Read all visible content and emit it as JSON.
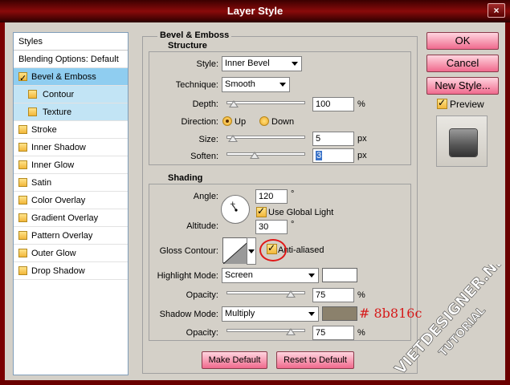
{
  "window": {
    "title": "Layer Style",
    "close_glyph": "×"
  },
  "styles_panel": {
    "header": "Styles",
    "items": [
      {
        "label": "Blending Options: Default",
        "checkbox": false,
        "checked": false,
        "indent": false,
        "selected": false
      },
      {
        "label": "Bevel & Emboss",
        "checkbox": true,
        "checked": true,
        "indent": false,
        "selected": true
      },
      {
        "label": "Contour",
        "checkbox": true,
        "checked": false,
        "indent": true,
        "selected": "sub"
      },
      {
        "label": "Texture",
        "checkbox": true,
        "checked": false,
        "indent": true,
        "selected": "sub"
      },
      {
        "label": "Stroke",
        "checkbox": true,
        "checked": false,
        "indent": false,
        "selected": false
      },
      {
        "label": "Inner Shadow",
        "checkbox": true,
        "checked": false,
        "indent": false,
        "selected": false
      },
      {
        "label": "Inner Glow",
        "checkbox": true,
        "checked": false,
        "indent": false,
        "selected": false
      },
      {
        "label": "Satin",
        "checkbox": true,
        "checked": false,
        "indent": false,
        "selected": false
      },
      {
        "label": "Color Overlay",
        "checkbox": true,
        "checked": false,
        "indent": false,
        "selected": false
      },
      {
        "label": "Gradient Overlay",
        "checkbox": true,
        "checked": false,
        "indent": false,
        "selected": false
      },
      {
        "label": "Pattern Overlay",
        "checkbox": true,
        "checked": false,
        "indent": false,
        "selected": false
      },
      {
        "label": "Outer Glow",
        "checkbox": true,
        "checked": false,
        "indent": false,
        "selected": false
      },
      {
        "label": "Drop Shadow",
        "checkbox": true,
        "checked": false,
        "indent": false,
        "selected": false
      }
    ]
  },
  "bevel": {
    "title": "Bevel & Emboss",
    "structure": {
      "title": "Structure",
      "style_label": "Style:",
      "style_value": "Inner Bevel",
      "technique_label": "Technique:",
      "technique_value": "Smooth",
      "depth_label": "Depth:",
      "depth_value": "100",
      "depth_unit": "%",
      "depth_level": 0.03,
      "direction_label": "Direction:",
      "direction_up": "Up",
      "direction_down": "Down",
      "direction_selected": "Up",
      "size_label": "Size:",
      "size_value": "5",
      "size_unit": "px",
      "size_level": 0.02,
      "soften_label": "Soften:",
      "soften_value": "3",
      "soften_unit": "px",
      "soften_level": 0.3
    },
    "shading": {
      "title": "Shading",
      "angle_label": "Angle:",
      "angle_value": "120",
      "angle_unit": "°",
      "use_global_light": "Use Global Light",
      "use_global_light_checked": true,
      "altitude_label": "Altitude:",
      "altitude_value": "30",
      "altitude_unit": "°",
      "gloss_contour_label": "Gloss Contour:",
      "anti_aliased": "Anti-aliased",
      "anti_aliased_checked": true,
      "highlight_mode_label": "Highlight Mode:",
      "highlight_mode_value": "Screen",
      "highlight_color": "#ffffff",
      "highlight_opacity_label": "Opacity:",
      "highlight_opacity_value": "75",
      "highlight_opacity_unit": "%",
      "highlight_opacity_level": 0.75,
      "shadow_mode_label": "Shadow Mode:",
      "shadow_mode_value": "Multiply",
      "shadow_color": "#8b816c",
      "shadow_opacity_label": "Opacity:",
      "shadow_opacity_value": "75",
      "shadow_opacity_unit": "%",
      "shadow_opacity_level": 0.75
    },
    "make_default": "Make Default",
    "reset_default": "Reset to Default"
  },
  "annotation": {
    "hex": "# 8b816c"
  },
  "right": {
    "ok": "OK",
    "cancel": "Cancel",
    "new_style": "New Style...",
    "preview_label": "Preview",
    "preview_checked": true
  },
  "watermark": {
    "site": "VIETDESIGNER.NET",
    "sub": "TUTORIAL"
  },
  "colors": {
    "accent_pink": "#f06a8e",
    "title_red": "#8a0a0a",
    "selection_blue": "#8fcdf0"
  }
}
